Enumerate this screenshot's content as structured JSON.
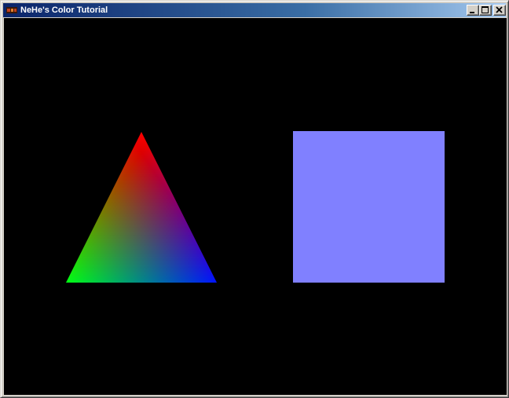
{
  "window": {
    "title": "NeHe's Color Tutorial",
    "titlebar_gradient_start": "#0a246a",
    "titlebar_gradient_end": "#a6caf0",
    "app_icon": "opengl-app-icon",
    "buttons": {
      "minimize_icon": "minimize-icon",
      "maximize_icon": "maximize-icon",
      "close_icon": "close-icon"
    }
  },
  "scene": {
    "background_color": "#000000",
    "triangle": {
      "vertex_colors": {
        "top": "#ff0000",
        "bottom_left": "#00ff00",
        "bottom_right": "#0000ff"
      }
    },
    "square": {
      "color": "#8080ff"
    }
  }
}
